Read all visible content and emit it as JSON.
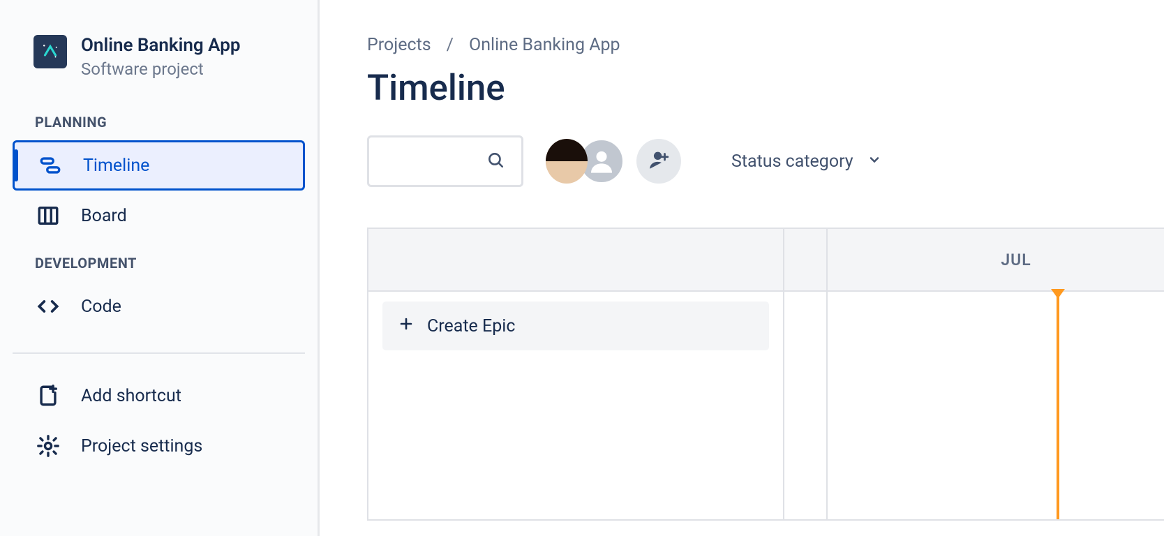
{
  "project": {
    "name": "Online Banking App",
    "subtitle": "Software project"
  },
  "sidebar": {
    "sections": {
      "planning": "PLANNING",
      "development": "DEVELOPMENT"
    },
    "items": {
      "timeline": "Timeline",
      "board": "Board",
      "code": "Code",
      "add_shortcut": "Add shortcut",
      "project_settings": "Project settings"
    }
  },
  "breadcrumb": {
    "root": "Projects",
    "current": "Online Banking App"
  },
  "page_title": "Timeline",
  "toolbar": {
    "status_category": "Status category"
  },
  "timeline": {
    "create_epic": "Create Epic",
    "month": "JUL"
  }
}
